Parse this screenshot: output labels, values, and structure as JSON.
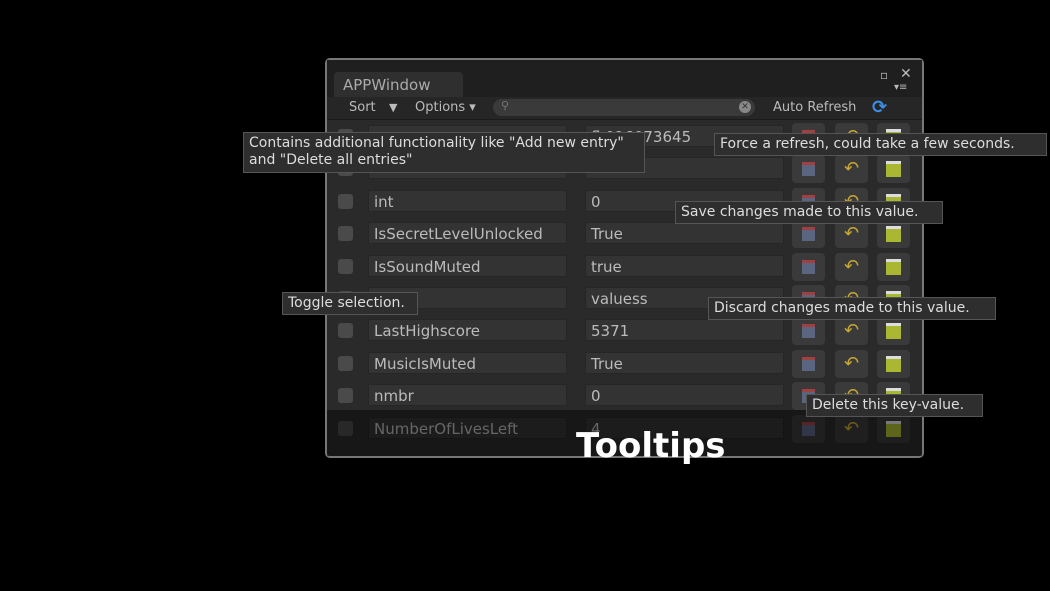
{
  "window": {
    "tab": "APPWindow",
    "maximize_icon": "▫",
    "close_icon": "✕",
    "menu_icon": "▾≡"
  },
  "toolbar": {
    "sort": "Sort",
    "sort_arrow": "▼",
    "options": "Options ▾",
    "search_placeholder": "",
    "auto_refresh": "Auto Refresh",
    "refresh_icon": "⟳"
  },
  "rows": [
    {
      "key": "",
      "value": "fl 016073645"
    },
    {
      "key": "",
      "value": ""
    },
    {
      "key": "int",
      "value": "0"
    },
    {
      "key": "IsSecretLevelUnlocked",
      "value": "True"
    },
    {
      "key": "IsSoundMuted",
      "value": "true"
    },
    {
      "key": "",
      "value": "valuess"
    },
    {
      "key": "LastHighscore",
      "value": "5371"
    },
    {
      "key": "MusicIsMuted",
      "value": "True"
    },
    {
      "key": "nmbr",
      "value": "0"
    },
    {
      "key": "NumberOfLivesLeft",
      "value": "4"
    }
  ],
  "tooltips": {
    "options": "Contains additional functionality like \"Add new entry\" and \"Delete all entries\"",
    "refresh": "Force a refresh, could take a few seconds.",
    "save": "Save changes made to this value.",
    "toggle": "Toggle selection.",
    "discard": "Discard changes made to this value.",
    "delete": "Delete this key-value."
  },
  "caption": "Tooltips"
}
